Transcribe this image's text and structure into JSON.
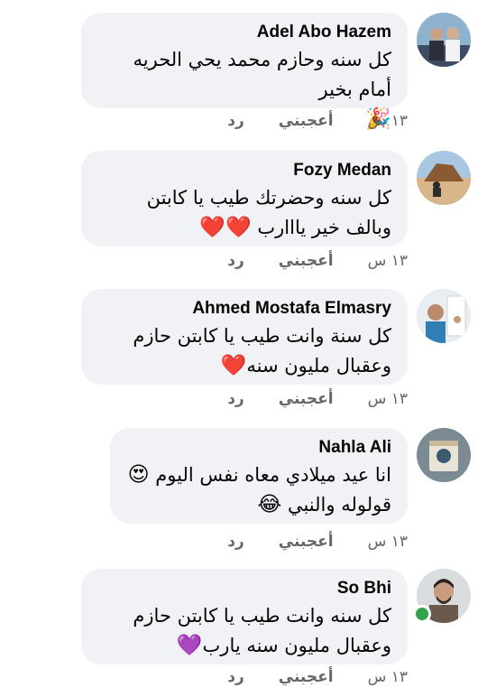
{
  "comments": [
    {
      "author": "Adel Abo Hazem",
      "text": "كل سنه وحازم محمد يحي الحريه أمام بخير",
      "emoji": "🎉",
      "time": "١٣ س",
      "like_label": "أعجبني",
      "reply_label": "رد",
      "online": false
    },
    {
      "author": "Fozy Medan",
      "text": "كل سنه وحضرتك طيب يا كابتن وبالف خير يااارب",
      "emoji": "❤️❤️",
      "time": "١٣ س",
      "like_label": "أعجبني",
      "reply_label": "رد",
      "online": false
    },
    {
      "author": "Ahmed Mostafa Elmasry",
      "text": "كل سنة وانت طيب يا كابتن حازم وعقبال مليون سنه",
      "emoji": "❤️",
      "time": "١٣ س",
      "like_label": "أعجبني",
      "reply_label": "رد",
      "online": false
    },
    {
      "author": "Nahla Ali",
      "text_line1": "انا عيد ميلادي معاه نفس اليوم",
      "emoji1": "😍",
      "text_line2": "قولوله والنبي",
      "emoji2": "😂",
      "time": "١٣ س",
      "like_label": "أعجبني",
      "reply_label": "رد",
      "online": false
    },
    {
      "author": "So Bhi",
      "text": "كل سنه وانت طيب يا كابتن حازم وعقبال مليون سنه يارب",
      "emoji": "💜",
      "time": "١٣ س",
      "like_label": "أعجبني",
      "reply_label": "رد",
      "online": true
    }
  ],
  "colors": {
    "bubble_bg": "#f0f2f5",
    "meta_text": "#65676b",
    "online": "#31a24c"
  }
}
